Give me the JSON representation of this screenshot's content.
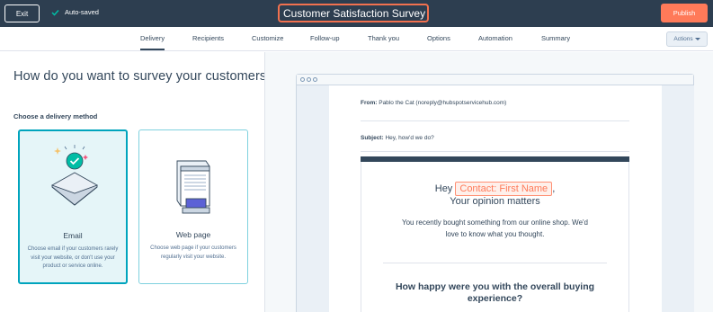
{
  "topbar": {
    "exit_label": "Exit",
    "autosaved_label": "Auto-saved",
    "survey_title": "Customer Satisfaction Survey",
    "publish_label": "Publish"
  },
  "tabs": [
    {
      "label": "Delivery",
      "active": true
    },
    {
      "label": "Recipients",
      "active": false
    },
    {
      "label": "Customize",
      "active": false
    },
    {
      "label": "Follow-up",
      "active": false
    },
    {
      "label": "Thank you",
      "active": false
    },
    {
      "label": "Options",
      "active": false
    },
    {
      "label": "Automation",
      "active": false
    },
    {
      "label": "Summary",
      "active": false
    }
  ],
  "actions_label": "Actions",
  "left": {
    "question": "How do you want to survey your customers?",
    "choose_label": "Choose a delivery method",
    "cards": [
      {
        "title": "Email",
        "desc": "Choose email if your customers rarely visit your website, or don't use your product or service online.",
        "selected": true
      },
      {
        "title": "Web page",
        "desc": "Choose web page if your customers regularly visit your website.",
        "selected": false
      }
    ]
  },
  "preview": {
    "from_label": "From:",
    "from_value": "Pablo the Cat (noreply@hubspotservicehub.com)",
    "subject_label": "Subject:",
    "subject_value": "Hey, how'd we do?",
    "hey": "Hey",
    "token": "Contact: First Name",
    "comma": ",",
    "opinion": "Your opinion matters",
    "bought": "You recently bought something from our online shop. We'd love to know what you thought.",
    "happy": "How happy were you with the overall buying experience?"
  },
  "colors": {
    "topbar": "#2d3e50",
    "accent": "#ff7a59",
    "selected_card_border": "#00a4bd"
  }
}
